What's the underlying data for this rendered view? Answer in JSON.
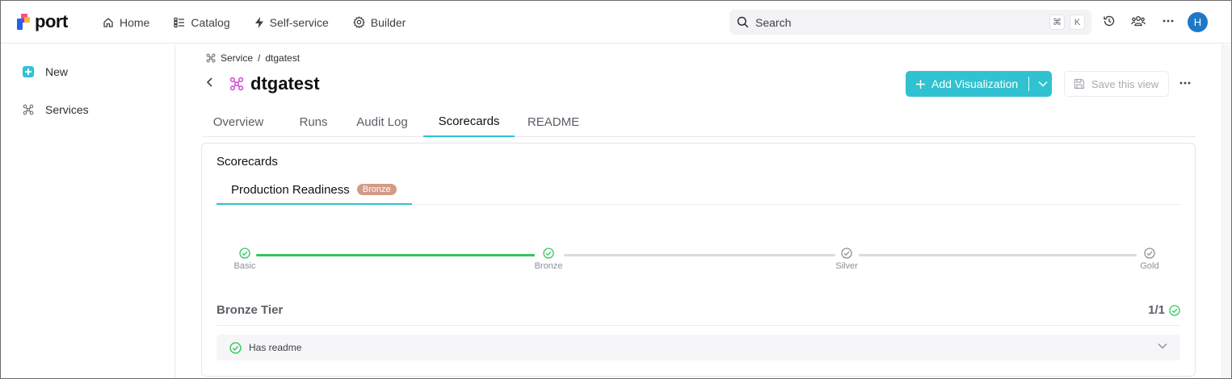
{
  "app": {
    "logo_text": "port"
  },
  "nav": [
    {
      "label": "Home",
      "icon": "home-icon"
    },
    {
      "label": "Catalog",
      "icon": "catalog-icon"
    },
    {
      "label": "Self-service",
      "icon": "lightning-icon"
    },
    {
      "label": "Builder",
      "icon": "gear-icon"
    }
  ],
  "search": {
    "placeholder": "Search",
    "shortcut_mod": "⌘",
    "shortcut_key": "K"
  },
  "user": {
    "avatar_initial": "H"
  },
  "sidebar": {
    "items": [
      {
        "label": "New",
        "icon": "plus-square-icon"
      },
      {
        "label": "Services",
        "icon": "service-icon"
      }
    ]
  },
  "breadcrumb": {
    "parent": "Service",
    "separator": "/",
    "current": "dtgatest"
  },
  "page": {
    "title": "dtgatest"
  },
  "actions": {
    "add_visualization": "Add Visualization",
    "save_view": "Save this view"
  },
  "tabs": [
    {
      "label": "Overview",
      "active": false
    },
    {
      "label": "Runs",
      "active": false
    },
    {
      "label": "Audit Log",
      "active": false
    },
    {
      "label": "Scorecards",
      "active": true
    },
    {
      "label": "README",
      "active": false
    }
  ],
  "scorecards": {
    "title": "Scorecards",
    "active_scorecard": {
      "name": "Production Readiness",
      "level": "Bronze",
      "level_color": "#d49a86"
    },
    "milestones": [
      {
        "label": "Basic",
        "achieved": true
      },
      {
        "label": "Bronze",
        "achieved": true
      },
      {
        "label": "Silver",
        "achieved": false
      },
      {
        "label": "Gold",
        "achieved": false
      }
    ],
    "tier": {
      "title": "Bronze Tier",
      "count": "1/1"
    },
    "rules": [
      {
        "label": "Has readme",
        "passed": true
      }
    ]
  },
  "colors": {
    "accent": "#30c2d0",
    "success": "#31c75a",
    "avatar": "#1e78c8"
  }
}
